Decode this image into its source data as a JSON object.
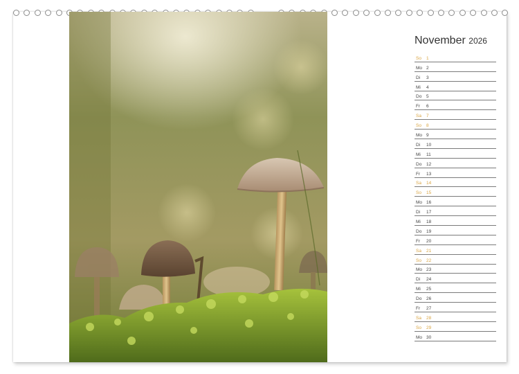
{
  "calendar": {
    "month": "November",
    "year": "2026",
    "days": [
      {
        "wd": "So",
        "d": "1",
        "weekend": true
      },
      {
        "wd": "Mo",
        "d": "2",
        "weekend": false
      },
      {
        "wd": "Di",
        "d": "3",
        "weekend": false
      },
      {
        "wd": "Mi",
        "d": "4",
        "weekend": false
      },
      {
        "wd": "Do",
        "d": "5",
        "weekend": false
      },
      {
        "wd": "Fr",
        "d": "6",
        "weekend": false
      },
      {
        "wd": "Sa",
        "d": "7",
        "weekend": true
      },
      {
        "wd": "So",
        "d": "8",
        "weekend": true
      },
      {
        "wd": "Mo",
        "d": "9",
        "weekend": false
      },
      {
        "wd": "Di",
        "d": "10",
        "weekend": false
      },
      {
        "wd": "Mi",
        "d": "11",
        "weekend": false
      },
      {
        "wd": "Do",
        "d": "12",
        "weekend": false
      },
      {
        "wd": "Fr",
        "d": "13",
        "weekend": false
      },
      {
        "wd": "Sa",
        "d": "14",
        "weekend": true
      },
      {
        "wd": "So",
        "d": "15",
        "weekend": true
      },
      {
        "wd": "Mo",
        "d": "16",
        "weekend": false
      },
      {
        "wd": "Di",
        "d": "17",
        "weekend": false
      },
      {
        "wd": "Mi",
        "d": "18",
        "weekend": false
      },
      {
        "wd": "Do",
        "d": "19",
        "weekend": false
      },
      {
        "wd": "Fr",
        "d": "20",
        "weekend": false
      },
      {
        "wd": "Sa",
        "d": "21",
        "weekend": true
      },
      {
        "wd": "So",
        "d": "22",
        "weekend": true
      },
      {
        "wd": "Mo",
        "d": "23",
        "weekend": false
      },
      {
        "wd": "Di",
        "d": "24",
        "weekend": false
      },
      {
        "wd": "Mi",
        "d": "25",
        "weekend": false
      },
      {
        "wd": "Do",
        "d": "26",
        "weekend": false
      },
      {
        "wd": "Fr",
        "d": "27",
        "weekend": false
      },
      {
        "wd": "Sa",
        "d": "28",
        "weekend": true
      },
      {
        "wd": "So",
        "d": "29",
        "weekend": true
      },
      {
        "wd": "Mo",
        "d": "30",
        "weekend": false
      }
    ]
  },
  "colors": {
    "weekend": "#d9a441",
    "weekday": "#444444",
    "rule": "#7a7a7a"
  },
  "photo": {
    "subject": "mushrooms-on-moss"
  }
}
